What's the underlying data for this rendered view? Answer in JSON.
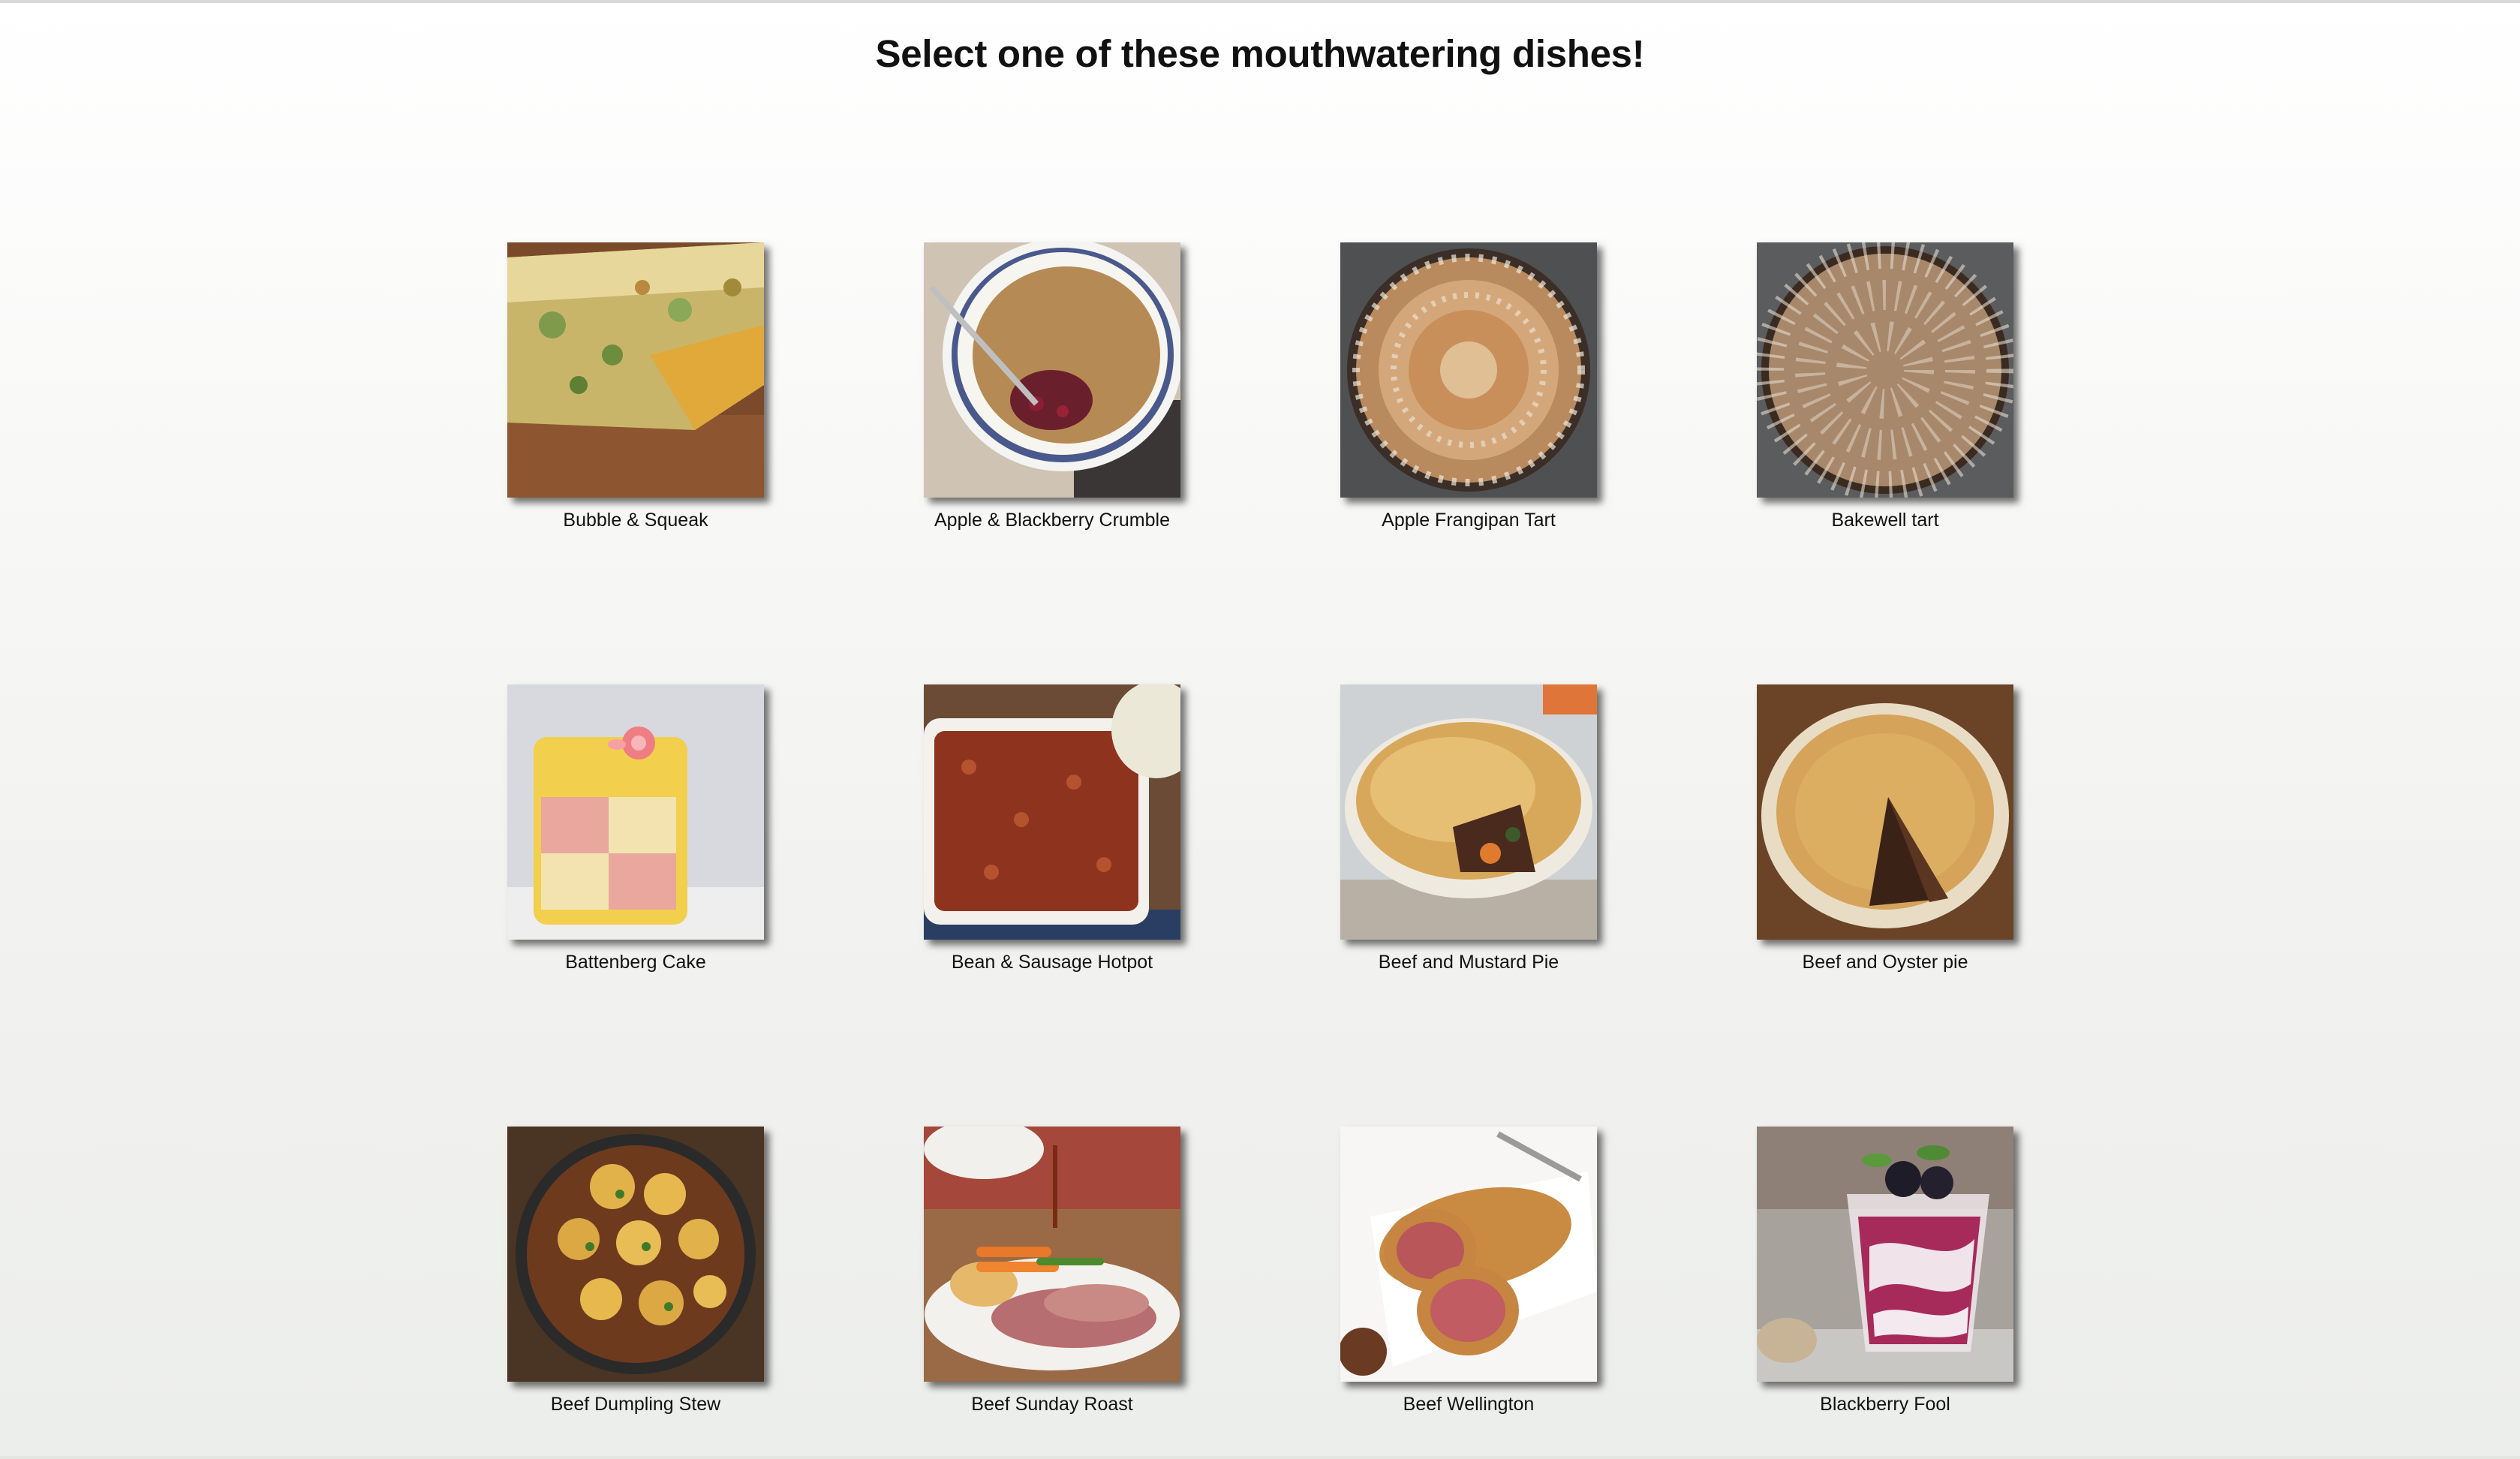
{
  "page": {
    "title": "Select one of these mouthwatering dishes!"
  },
  "dishes": [
    {
      "name": "Bubble & Squeak",
      "icon": "bubble-and-squeak-photo"
    },
    {
      "name": "Apple & Blackberry Crumble",
      "icon": "apple-blackberry-crumble-photo"
    },
    {
      "name": "Apple Frangipan Tart",
      "icon": "apple-frangipan-tart-photo"
    },
    {
      "name": "Bakewell tart",
      "icon": "bakewell-tart-photo"
    },
    {
      "name": "Battenberg Cake",
      "icon": "battenberg-cake-photo"
    },
    {
      "name": "Bean & Sausage Hotpot",
      "icon": "bean-sausage-hotpot-photo"
    },
    {
      "name": "Beef and Mustard Pie",
      "icon": "beef-mustard-pie-photo"
    },
    {
      "name": "Beef and Oyster pie",
      "icon": "beef-oyster-pie-photo"
    },
    {
      "name": "Beef Dumpling Stew",
      "icon": "beef-dumpling-stew-photo"
    },
    {
      "name": "Beef Sunday Roast",
      "icon": "beef-sunday-roast-photo"
    },
    {
      "name": "Beef Wellington",
      "icon": "beef-wellington-photo"
    },
    {
      "name": "Blackberry Fool",
      "icon": "blackberry-fool-photo"
    }
  ]
}
